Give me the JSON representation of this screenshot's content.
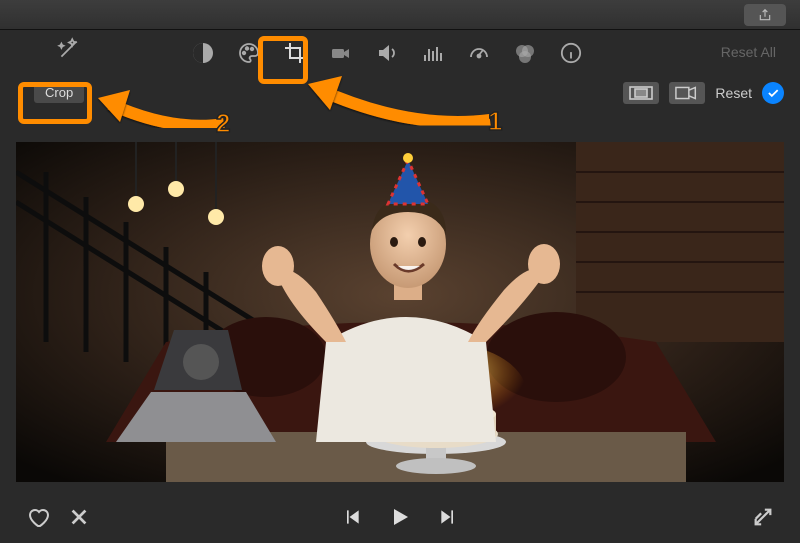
{
  "titlebar": {
    "share_icon": "share-icon"
  },
  "toolbar": {
    "wand_icon": "magic-wand-icon",
    "tools": {
      "color_balance": "color-balance-icon",
      "color_correct": "color-palette-icon",
      "crop": "crop-icon",
      "stabilize": "video-camera-icon",
      "volume": "volume-icon",
      "noise": "equalizer-icon",
      "speed": "speedometer-icon",
      "filter": "overlapping-circles-icon",
      "info": "info-icon"
    },
    "reset_all": "Reset All"
  },
  "subbar": {
    "crop_label": "Crop",
    "style_fit": "fit-icon",
    "style_kenburns": "ken-burns-icon",
    "reset_label": "Reset",
    "confirm_icon": "checkmark-icon"
  },
  "annotations": {
    "num1": "1",
    "num2": "2"
  },
  "bottombar": {
    "favorite": "heart-icon",
    "reject": "x-icon",
    "prev": "previous-icon",
    "play": "play-icon",
    "next": "next-icon",
    "fullscreen": "fullscreen-icon"
  }
}
